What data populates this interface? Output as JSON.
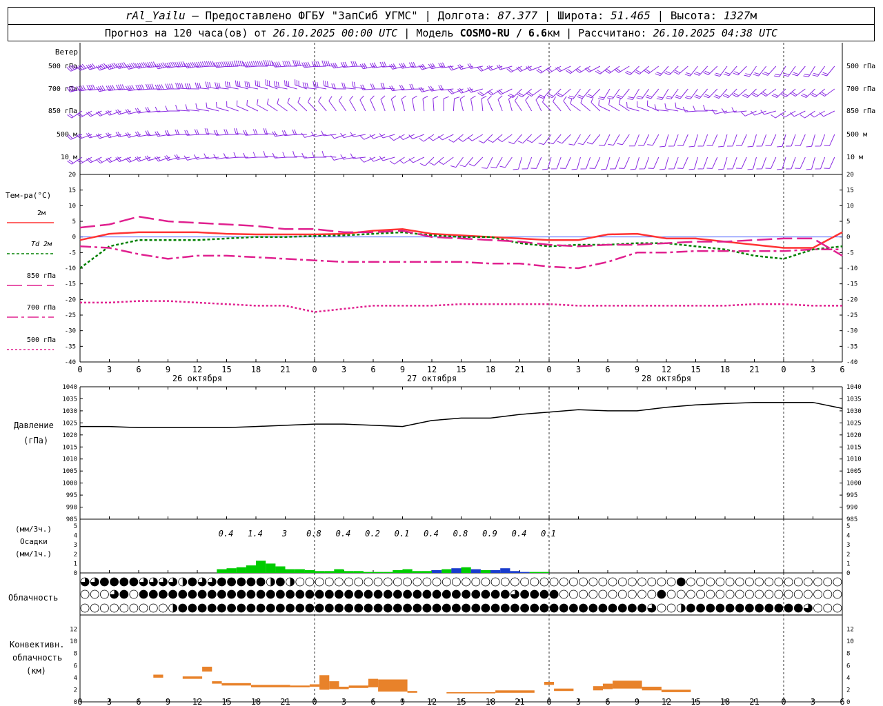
{
  "header": {
    "station": "rAl_Yailu",
    "provider": " – Предоставлено ФГБУ \"ЗапСиб УГМС\" | Долгота: ",
    "lon": "87.377",
    "lat_label": " | Широта: ",
    "lat": "51.465",
    "alt_label": " | Высота: ",
    "alt": "1327",
    "alt_unit": "м",
    "forecast_label": "Прогноз на 120 часа(ов) от ",
    "forecast_from": "26.10.2025 00:00 UTC",
    "model_label": "  | Модель ",
    "model": "COSMO-RU / 6.6",
    "model_unit": "км",
    "calc_label": " | Рассчитано: ",
    "calc_time": "26.10.2025 04:38 UTC"
  },
  "chart_data": [
    {
      "type": "wind-barbs",
      "label": "Ветер",
      "levels": [
        "500 гПа",
        "700 гПа",
        "850 гПа",
        "500 м",
        "10 м"
      ],
      "color": "#8a2be2"
    },
    {
      "type": "line",
      "ylabel": "Тем-ра(°С)",
      "ylim": [
        -40,
        20
      ],
      "yticks": [
        20,
        15,
        10,
        5,
        0,
        -5,
        -10,
        -15,
        -20,
        -25,
        -30,
        -35,
        -40
      ],
      "x_hours": [
        0,
        3,
        6,
        9,
        12,
        15,
        18,
        21,
        24,
        27,
        30,
        33,
        36,
        39,
        42,
        45,
        48,
        51,
        54,
        57,
        60,
        63,
        66,
        69,
        72,
        75,
        78
      ],
      "series": [
        {
          "name": "2м",
          "color": "#ff3333",
          "dash": "",
          "values": [
            -1,
            1,
            1.5,
            1.5,
            1.5,
            1,
            0.8,
            0.8,
            0.8,
            1,
            2,
            2.5,
            1,
            0.5,
            0,
            -0.5,
            -1,
            -1,
            0.8,
            1,
            -0.5,
            -0.5,
            -1.5,
            -2.5,
            -3.5,
            -3.5,
            1.5
          ]
        },
        {
          "name": "Td  2м",
          "color": "#008000",
          "dash": "4,3",
          "values": [
            -10,
            -3,
            -1,
            -1,
            -1,
            -0.5,
            0,
            0,
            0.3,
            0.5,
            1,
            1.5,
            0.5,
            0,
            0,
            -2,
            -3,
            -2.5,
            -2.5,
            -2,
            -2,
            -3,
            -4,
            -6,
            -7,
            -4,
            -3
          ]
        },
        {
          "name": "850 гПа",
          "color": "#e0208f",
          "dash": "22,7",
          "values": [
            3,
            4,
            6.5,
            5,
            4.5,
            4,
            3.5,
            2.5,
            2.5,
            1.5,
            1.5,
            2,
            0,
            -0.5,
            -1,
            -1.5,
            -2.5,
            -3,
            -2.5,
            -2.5,
            -2,
            -1.5,
            -1.5,
            -1,
            -0.5,
            -0.5,
            -6
          ]
        },
        {
          "name": "700 гПа",
          "color": "#e0208f",
          "dash": "16,5,4,5",
          "values": [
            -3,
            -3.5,
            -5.5,
            -7,
            -6,
            -6,
            -6.5,
            -7,
            -7.5,
            -8,
            -8,
            -8,
            -8,
            -8,
            -8.5,
            -8.5,
            -9.5,
            -10,
            -8,
            -5,
            -5,
            -4.5,
            -4.5,
            -4.5,
            -4.5,
            -4,
            -4
          ]
        },
        {
          "name": "500 гПа",
          "color": "#e0208f",
          "dash": "3,3",
          "values": [
            -21,
            -21,
            -20.5,
            -20.5,
            -21,
            -21.5,
            -22,
            -22,
            -24,
            -23,
            -22,
            -22,
            -22,
            -21.5,
            -21.5,
            -21.5,
            -21.5,
            -22,
            -22,
            -22,
            -22,
            -22,
            -22,
            -21.5,
            -21.5,
            -22,
            -22
          ]
        }
      ],
      "x_ticks": [
        "0",
        "3",
        "6",
        "9",
        "12",
        "15",
        "18",
        "21",
        "0",
        "3",
        "6",
        "9",
        "12",
        "15",
        "18",
        "21",
        "0",
        "3",
        "6",
        "9",
        "12",
        "15",
        "18",
        "21",
        "0",
        "3",
        "6"
      ],
      "day_labels": [
        "26 октября",
        "27 октября",
        "28 октября"
      ]
    },
    {
      "type": "line",
      "ylabel": "Давление",
      "yunit": "(гПа)",
      "ylim": [
        985,
        1040
      ],
      "yticks": [
        1040,
        1035,
        1030,
        1025,
        1020,
        1015,
        1010,
        1005,
        1000,
        995,
        990,
        985
      ],
      "x_hours": [
        0,
        3,
        6,
        9,
        12,
        15,
        18,
        21,
        24,
        27,
        30,
        33,
        36,
        39,
        42,
        45,
        48,
        51,
        54,
        57,
        60,
        63,
        66,
        69,
        72,
        75,
        78
      ],
      "values": [
        1023.5,
        1023.5,
        1023,
        1023,
        1023,
        1023,
        1023.5,
        1024,
        1024.5,
        1024.5,
        1024,
        1023.5,
        1026,
        1027,
        1027,
        1028.5,
        1029.5,
        1030.5,
        1030,
        1030,
        1031.5,
        1032.5,
        1033,
        1033.5,
        1033.5,
        1033.5,
        1031
      ],
      "color": "#000000"
    },
    {
      "type": "bar",
      "ylabel": "Осадки",
      "yunit_3h": "(мм/3ч.)",
      "yunit_1h": "(мм/1ч.)",
      "ylim": [
        0,
        5
      ],
      "yticks": [
        5,
        4,
        3,
        2,
        1,
        0
      ],
      "totals_3h": [
        "0.4",
        "1.4",
        "3",
        "0.8",
        "0.4",
        "0.2",
        "0.1",
        "0.4",
        "0.8",
        "0.9",
        "0.4",
        "0.1"
      ],
      "hours": [
        14,
        15,
        16,
        17,
        18,
        19,
        20,
        21,
        22,
        23,
        24,
        25,
        26,
        27,
        28,
        29,
        30,
        31,
        32,
        33,
        34,
        35,
        36,
        37,
        38,
        39,
        40,
        41,
        42,
        43,
        44,
        45,
        46,
        47
      ],
      "values": [
        0.4,
        0.5,
        0.6,
        0.8,
        1.3,
        1.0,
        0.7,
        0.4,
        0.4,
        0.3,
        0.2,
        0.2,
        0.4,
        0.2,
        0.2,
        0.1,
        0.1,
        0.1,
        0.3,
        0.4,
        0.2,
        0.2,
        0.3,
        0.4,
        0.5,
        0.6,
        0.4,
        0.3,
        0.3,
        0.5,
        0.2,
        0.1,
        0.1,
        0.1
      ],
      "colors": {
        "rain": "#00cc00",
        "snow": "#1a3ccc"
      },
      "snow_from_hour": 36
    },
    {
      "type": "table",
      "label": "Облачность",
      "rows": [
        "ppFFFFpppphFppFFFFFhFhOOOOOOOOOOOOOOOOOOOOOOOOOOOOOOOOOOOOOOOFOOOOOOOOOOOOOOOOOOOOOOOOOOOOOOOOOOOOOOOOOOOOOOp",
        "OOOpFOFFFFFFFFFFFFFFFFFFFFFFFFFFFFFFFFFFFFFFpFFFFOOOOOOOOOOFOOOOOOOOOOOOOOOOOOOOOOOOOOOOOOOOOOOOOOOOOOOOOOOOOOOO",
        "OOOOOOOOOhFFFFFFFFFFFFFFFFFFFFFFFFFFFFFFFFFFFFFFFFFFFFFFFFpOOhFFFFFFFFFFFFpOOOOOOOOOOOOOOOOOOOOOOOOOOOOOOOOOOOOOOO"
      ]
    },
    {
      "type": "bar",
      "ylabel": "Конвективн.",
      "ylabel2": "облачность",
      "yunit": "(км)",
      "ylim": [
        0,
        14
      ],
      "yticks": [
        12,
        10,
        8,
        6,
        4,
        2,
        0
      ],
      "color": "#e8822a",
      "bands": [
        {
          "from": 7.5,
          "to": 8.5,
          "bottom": 4,
          "top": 4.5
        },
        {
          "from": 10.5,
          "to": 12.5,
          "bottom": 3.8,
          "top": 4.2
        },
        {
          "from": 12.5,
          "to": 13.5,
          "bottom": 5,
          "top": 5.8
        },
        {
          "from": 13.5,
          "to": 14.5,
          "bottom": 3,
          "top": 3.4
        },
        {
          "from": 14.5,
          "to": 17.5,
          "bottom": 2.7,
          "top": 3.1
        },
        {
          "from": 17.5,
          "to": 21.5,
          "bottom": 2.4,
          "top": 2.8
        },
        {
          "from": 21.5,
          "to": 23.5,
          "bottom": 2.4,
          "top": 2.7
        },
        {
          "from": 23.5,
          "to": 24.5,
          "bottom": 2.5,
          "top": 2.9
        },
        {
          "from": 24.5,
          "to": 25.5,
          "bottom": 2,
          "top": 4.4
        },
        {
          "from": 25.5,
          "to": 26.5,
          "bottom": 2.1,
          "top": 3.4
        },
        {
          "from": 26.5,
          "to": 27.5,
          "bottom": 2.1,
          "top": 2.5
        },
        {
          "from": 27.5,
          "to": 29.5,
          "bottom": 2.3,
          "top": 2.7
        },
        {
          "from": 29.5,
          "to": 30.5,
          "bottom": 2.4,
          "top": 3.8
        },
        {
          "from": 30.5,
          "to": 33.5,
          "bottom": 1.7,
          "top": 3.7
        },
        {
          "from": 33.5,
          "to": 34.5,
          "bottom": 1.5,
          "top": 1.8
        },
        {
          "from": 37.5,
          "to": 42.5,
          "bottom": 1.4,
          "top": 1.6
        },
        {
          "from": 42.5,
          "to": 46.5,
          "bottom": 1.5,
          "top": 1.9
        },
        {
          "from": 47.5,
          "to": 48.5,
          "bottom": 2.8,
          "top": 3.3
        },
        {
          "from": 48.5,
          "to": 50.5,
          "bottom": 1.8,
          "top": 2.2
        },
        {
          "from": 52.5,
          "to": 53.5,
          "bottom": 1.9,
          "top": 2.6
        },
        {
          "from": 53.5,
          "to": 54.5,
          "bottom": 2.1,
          "top": 3.0
        },
        {
          "from": 54.5,
          "to": 57.5,
          "bottom": 2.2,
          "top": 3.5
        },
        {
          "from": 57.5,
          "to": 59.5,
          "bottom": 1.9,
          "top": 2.5
        },
        {
          "from": 59.5,
          "to": 62.5,
          "bottom": 1.6,
          "top": 2.0
        }
      ]
    }
  ],
  "wind_fields": {
    "500 гПа": {
      "dir": [
        250,
        255,
        260,
        262,
        265,
        268,
        270,
        270,
        268,
        265,
        262,
        260,
        258,
        255,
        250,
        245,
        240,
        238,
        235,
        230,
        225,
        222,
        220,
        218,
        215,
        215,
        215
      ],
      "spd": [
        40,
        45,
        50,
        50,
        50,
        45,
        45,
        40,
        35,
        30,
        30,
        25,
        25,
        20,
        20,
        20,
        15,
        15,
        15,
        15,
        15,
        15,
        15,
        15,
        15,
        20,
        20
      ]
    },
    "700 гПа": {
      "dir": [
        260,
        262,
        265,
        270,
        275,
        280,
        285,
        285,
        280,
        275,
        270,
        265,
        260,
        250,
        240,
        230,
        225,
        220,
        215,
        215,
        215,
        220,
        225,
        230,
        230,
        230,
        230
      ],
      "spd": [
        35,
        35,
        35,
        35,
        30,
        30,
        30,
        25,
        25,
        20,
        20,
        20,
        15,
        15,
        15,
        15,
        15,
        15,
        15,
        15,
        15,
        15,
        15,
        15,
        15,
        15,
        15
      ]
    },
    "850 гПа": {
      "dir": [
        240,
        250,
        260,
        270,
        280,
        290,
        300,
        310,
        320,
        330,
        340,
        350,
        0,
        350,
        340,
        330,
        320,
        310,
        300,
        290,
        280,
        270,
        260,
        250,
        240,
        240,
        240
      ],
      "spd": [
        15,
        15,
        15,
        10,
        10,
        10,
        10,
        5,
        5,
        5,
        5,
        5,
        5,
        5,
        5,
        5,
        5,
        5,
        5,
        5,
        5,
        5,
        5,
        5,
        5,
        5,
        5
      ]
    },
    "500 м": {
      "dir": [
        250,
        255,
        260,
        265,
        270,
        270,
        270,
        265,
        260,
        255,
        250,
        245,
        240,
        235,
        230,
        225,
        220,
        215,
        210,
        205,
        200,
        200,
        200,
        200,
        200,
        200,
        200
      ],
      "spd": [
        20,
        20,
        20,
        20,
        15,
        15,
        15,
        15,
        10,
        10,
        10,
        10,
        10,
        10,
        10,
        10,
        10,
        10,
        10,
        10,
        10,
        10,
        10,
        10,
        10,
        10,
        10
      ]
    },
    "10 м": {
      "dir": [
        240,
        245,
        250,
        255,
        260,
        265,
        270,
        270,
        270,
        260,
        250,
        240,
        230,
        220,
        210,
        200,
        200,
        200,
        200,
        200,
        200,
        200,
        200,
        200,
        200,
        200,
        200
      ],
      "spd": [
        15,
        15,
        15,
        15,
        10,
        10,
        10,
        10,
        10,
        5,
        5,
        5,
        5,
        5,
        5,
        5,
        5,
        5,
        5,
        5,
        5,
        5,
        5,
        5,
        5,
        5,
        5
      ]
    }
  }
}
